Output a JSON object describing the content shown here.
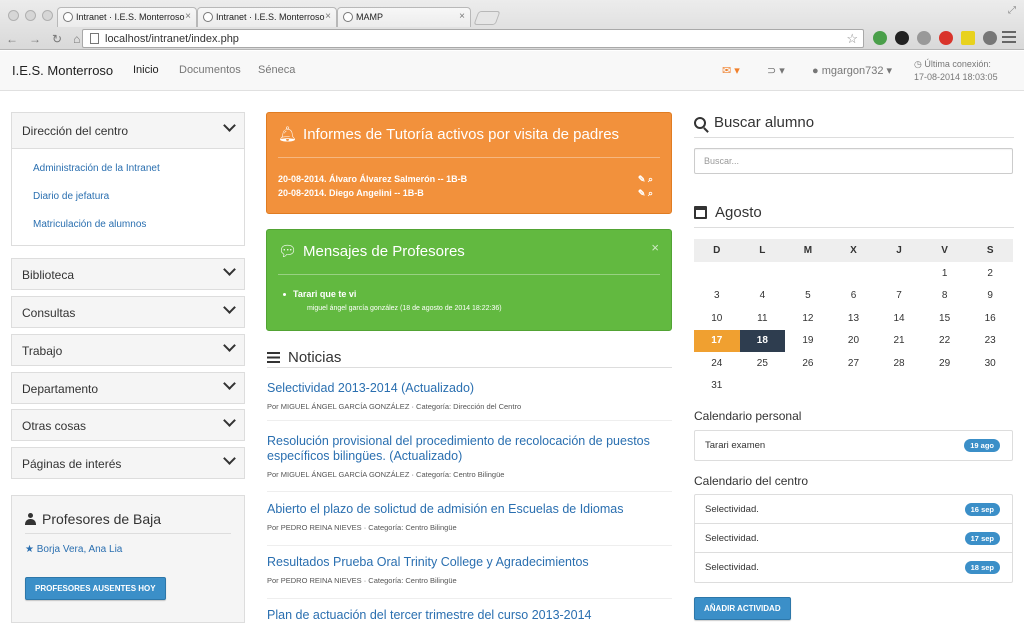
{
  "browser": {
    "tabs": [
      {
        "label": "Intranet · I.E.S. Monterroso"
      },
      {
        "label": "Intranet · I.E.S. Monterroso"
      },
      {
        "label": "MAMP"
      }
    ],
    "url": "localhost/intranet/index.php"
  },
  "navbar": {
    "brand": "I.E.S. Monterroso",
    "links": [
      "Inicio",
      "Documentos",
      "Séneca"
    ],
    "user": "mgargon732",
    "last_connection_label": "Última conexión:",
    "last_connection_value": "17-08-2014   18:03:05"
  },
  "sidebar": {
    "sections": [
      {
        "label": "Dirección del centro",
        "items": [
          "Administración de la Intranet",
          "Diario de jefatura",
          "Matriculación de alumnos"
        ]
      },
      {
        "label": "Biblioteca"
      },
      {
        "label": "Consultas"
      },
      {
        "label": "Trabajo"
      },
      {
        "label": "Departamento"
      },
      {
        "label": "Otras cosas"
      },
      {
        "label": "Páginas de interés"
      }
    ],
    "absent": {
      "title": "Profesores de Baja",
      "names": "Borja Vera, Ana Lia",
      "button": "PROFESORES AUSENTES HOY"
    }
  },
  "tutoria": {
    "title": "Informes de Tutoría activos por visita de padres",
    "items": [
      "20-08-2014. Álvaro Álvarez Salmerón -- 1B-B",
      "20-08-2014. Diego Angelini -- 1B-B"
    ]
  },
  "mensajes": {
    "title": "Mensajes de Profesores",
    "close": "×",
    "message": "Tarari que te vi",
    "meta": "miguel ángel garcía gonzález (18 de agosto de 2014 18:22:36)"
  },
  "noticias": {
    "title": "Noticias",
    "items": [
      {
        "title": "Selectividad 2013-2014 (Actualizado)",
        "meta": "Por MIGUEL ÁNGEL GARCÍA GONZÁLEZ · Categoría: Dirección del Centro"
      },
      {
        "title": "Resolución provisional del procedimiento de recolocación de puestos específicos bilingües. (Actualizado)",
        "meta": "Por MIGUEL ÁNGEL GARCÍA GONZÁLEZ · Categoría: Centro Bilingüe"
      },
      {
        "title": "Abierto el plazo de solictud de admisión en Escuelas de Idiomas",
        "meta": "Por PEDRO REINA NIEVES · Categoría: Centro Bilingüe"
      },
      {
        "title": "Resultados Prueba Oral Trinity College y Agradecimientos",
        "meta": "Por PEDRO REINA NIEVES · Categoría: Centro Bilingüe"
      },
      {
        "title": "Plan de actuación del tercer trimestre del curso 2013-2014",
        "meta": ""
      }
    ]
  },
  "buscar": {
    "title": "Buscar alumno",
    "placeholder": "Buscar..."
  },
  "calendar": {
    "month": "Agosto",
    "days": [
      "D",
      "L",
      "M",
      "X",
      "J",
      "V",
      "S"
    ],
    "weeks": [
      [
        "",
        "",
        "",
        "",
        "",
        "1",
        "2"
      ],
      [
        "3",
        "4",
        "5",
        "6",
        "7",
        "8",
        "9"
      ],
      [
        "10",
        "11",
        "12",
        "13",
        "14",
        "15",
        "16"
      ],
      [
        "17",
        "18",
        "19",
        "20",
        "21",
        "22",
        "23"
      ],
      [
        "24",
        "25",
        "26",
        "27",
        "28",
        "29",
        "30"
      ],
      [
        "31",
        "",
        "",
        "",
        "",
        "",
        ""
      ]
    ],
    "today": "17",
    "selected": "18",
    "today_color": "#f0a030",
    "selected_color": "#2e3d4f"
  },
  "personal_calendar": {
    "title": "Calendario personal",
    "items": [
      {
        "label": "Tarari examen",
        "date": "19 ago"
      }
    ]
  },
  "centre_calendar": {
    "title": "Calendario del centro",
    "items": [
      {
        "label": "Selectividad.",
        "date": "16 sep"
      },
      {
        "label": "Selectividad.",
        "date": "17 sep"
      },
      {
        "label": "Selectividad.",
        "date": "18 sep"
      }
    ],
    "button": "AÑADIR ACTIVIDAD"
  },
  "colors": {
    "accent_blue": "#3b8fc8",
    "orange": "#f2913c",
    "green": "#62b940",
    "link": "#2a6fb0"
  }
}
